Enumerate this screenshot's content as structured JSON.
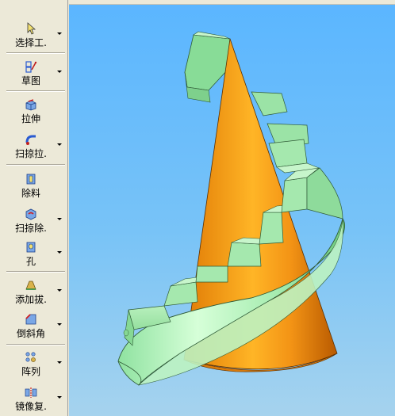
{
  "toolbar": {
    "items": [
      {
        "label": "选择工.",
        "icon": "select-arrow-icon",
        "dropdown": true
      },
      {
        "label": "草图",
        "icon": "sketch-icon",
        "dropdown": true
      },
      {
        "label": "拉伸",
        "icon": "extrude-icon",
        "dropdown": false
      },
      {
        "label": "扫掠拉.",
        "icon": "sweep-extrude-icon",
        "dropdown": true
      },
      {
        "label": "除料",
        "icon": "cut-icon",
        "dropdown": false
      },
      {
        "label": "扫掠除.",
        "icon": "sweep-cut-icon",
        "dropdown": true
      },
      {
        "label": "孔",
        "icon": "hole-icon",
        "dropdown": true
      },
      {
        "label": "添加拔.",
        "icon": "add-draft-icon",
        "dropdown": true
      },
      {
        "label": "倒斜角",
        "icon": "chamfer-icon",
        "dropdown": true
      },
      {
        "label": "阵列",
        "icon": "pattern-icon",
        "dropdown": true
      },
      {
        "label": "镜像复.",
        "icon": "mirror-copy-icon",
        "dropdown": true
      }
    ]
  },
  "colors": {
    "cone": "#f59a1a",
    "stair": "#9be8a8",
    "background_top": "#5bb6ff",
    "background_bottom": "#a6d3ee"
  }
}
